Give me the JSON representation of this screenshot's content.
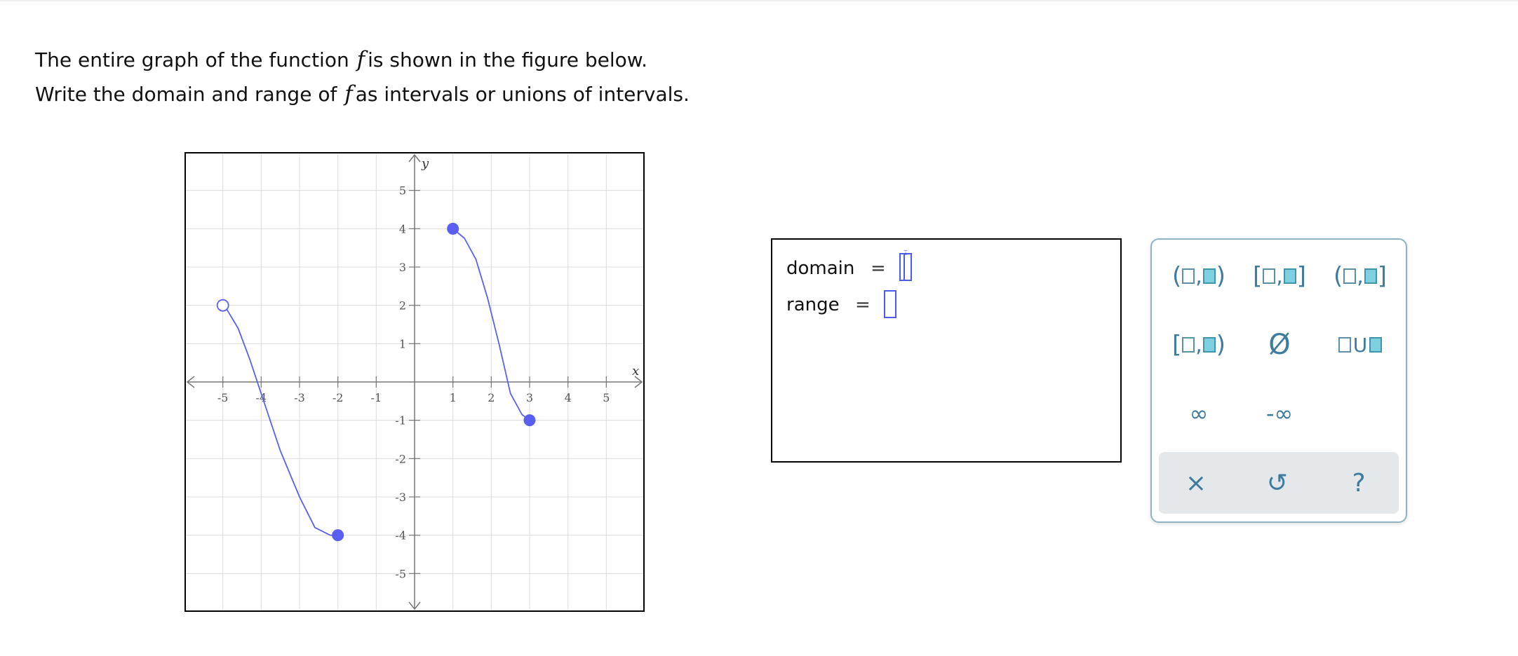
{
  "prompt": {
    "line1_before": "The entire graph of the function",
    "line1_var": "f",
    "line1_after": "is shown in the figure below.",
    "line2_before": "Write the domain and range of",
    "line2_var": "f",
    "line2_after": "as intervals or unions of intervals."
  },
  "graph": {
    "x_axis_label": "x",
    "y_axis_label": "y",
    "x_ticks": [
      "-5",
      "-4",
      "-3",
      "-2",
      "-1",
      "1",
      "2",
      "3",
      "4",
      "5"
    ],
    "y_ticks": [
      "5",
      "4",
      "3",
      "2",
      "1",
      "-1",
      "-2",
      "-3",
      "-4",
      "-5"
    ],
    "xlim": [
      -6,
      6
    ],
    "ylim": [
      -6,
      6
    ],
    "curve_color": "#5b5ff0",
    "curves": [
      {
        "points": [
          [
            -5,
            2
          ],
          [
            -4.9,
            1.9
          ],
          [
            -4.6,
            1.4
          ],
          [
            -4.3,
            0.6
          ],
          [
            -4,
            -0.3
          ],
          [
            -3.5,
            -1.8
          ],
          [
            -3,
            -3.0
          ],
          [
            -2.6,
            -3.8
          ],
          [
            -2.2,
            -4.0
          ],
          [
            -2,
            -4
          ]
        ]
      },
      {
        "points": [
          [
            1,
            4
          ],
          [
            1.3,
            3.75
          ],
          [
            1.6,
            3.2
          ],
          [
            1.9,
            2.2
          ],
          [
            2.2,
            1.0
          ],
          [
            2.5,
            -0.3
          ],
          [
            2.8,
            -0.85
          ],
          [
            3,
            -1
          ]
        ]
      }
    ],
    "endpoints": [
      {
        "x": -5,
        "y": 2,
        "filled": false
      },
      {
        "x": -2,
        "y": -4,
        "filled": true
      },
      {
        "x": 1,
        "y": 4,
        "filled": true
      },
      {
        "x": 3,
        "y": -1,
        "filled": true
      }
    ]
  },
  "answer": {
    "domain_label": "domain",
    "range_label": "range",
    "equals": "=",
    "domain_value": "",
    "range_value": ""
  },
  "palette": {
    "buttons": [
      {
        "name": "open-open-interval-button",
        "left": "(",
        "right": ")"
      },
      {
        "name": "closed-closed-interval-button",
        "left": "[",
        "right": "]"
      },
      {
        "name": "open-closed-interval-button",
        "left": "(",
        "right": "]"
      },
      {
        "name": "closed-open-interval-button",
        "left": "[",
        "right": ")"
      }
    ],
    "empty_set": "Ø",
    "union_symbol": "U",
    "infinity": "∞",
    "neg_infinity": "-∞",
    "clear": "×",
    "undo": "↺",
    "help": "?"
  }
}
